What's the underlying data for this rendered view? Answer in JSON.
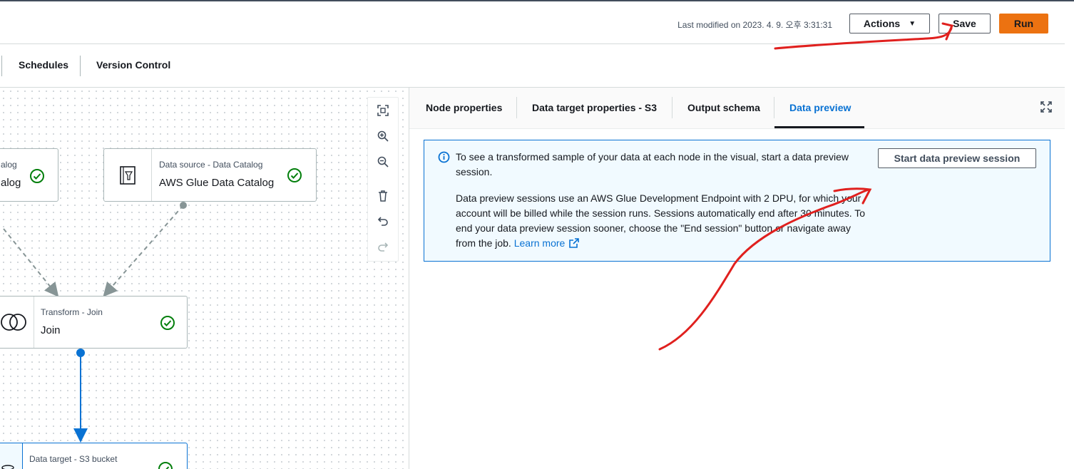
{
  "header": {
    "last_modified": "Last modified on 2023. 4. 9. 오후 3:31:31",
    "actions_label": "Actions",
    "save_label": "Save",
    "run_label": "Run"
  },
  "subtabs": [
    "Schedules",
    "Version Control"
  ],
  "canvas": {
    "nodes": [
      {
        "type": "alog",
        "name": "alog"
      },
      {
        "type": "Data source - Data Catalog",
        "name": "AWS Glue Data Catalog"
      },
      {
        "type": "Transform - Join",
        "name": "Join"
      },
      {
        "type": "Data target - S3 bucket",
        "name": ""
      }
    ],
    "tools": [
      "fit-view-icon",
      "zoom-in-icon",
      "zoom-out-icon",
      "trash-icon",
      "undo-icon",
      "redo-icon"
    ]
  },
  "panel": {
    "tabs": [
      "Node properties",
      "Data target properties - S3",
      "Output schema",
      "Data preview"
    ],
    "active_tab": "Data preview",
    "info": {
      "line1": "To see a transformed sample of your data at each node in the visual, start a data preview session.",
      "line2": "Data preview sessions use an AWS Glue Development Endpoint with 2 DPU, for which your account will be billed while the session runs. Sessions automatically end after 30 minutes. To end your data preview session sooner, choose the \"End session\" button or navigate away from the job.",
      "learn_more": "Learn more",
      "button": "Start data preview session"
    }
  },
  "colors": {
    "accent": "#0972d3",
    "run_button": "#ec7211",
    "success": "#037f0c",
    "annotation": "#e0201e"
  }
}
